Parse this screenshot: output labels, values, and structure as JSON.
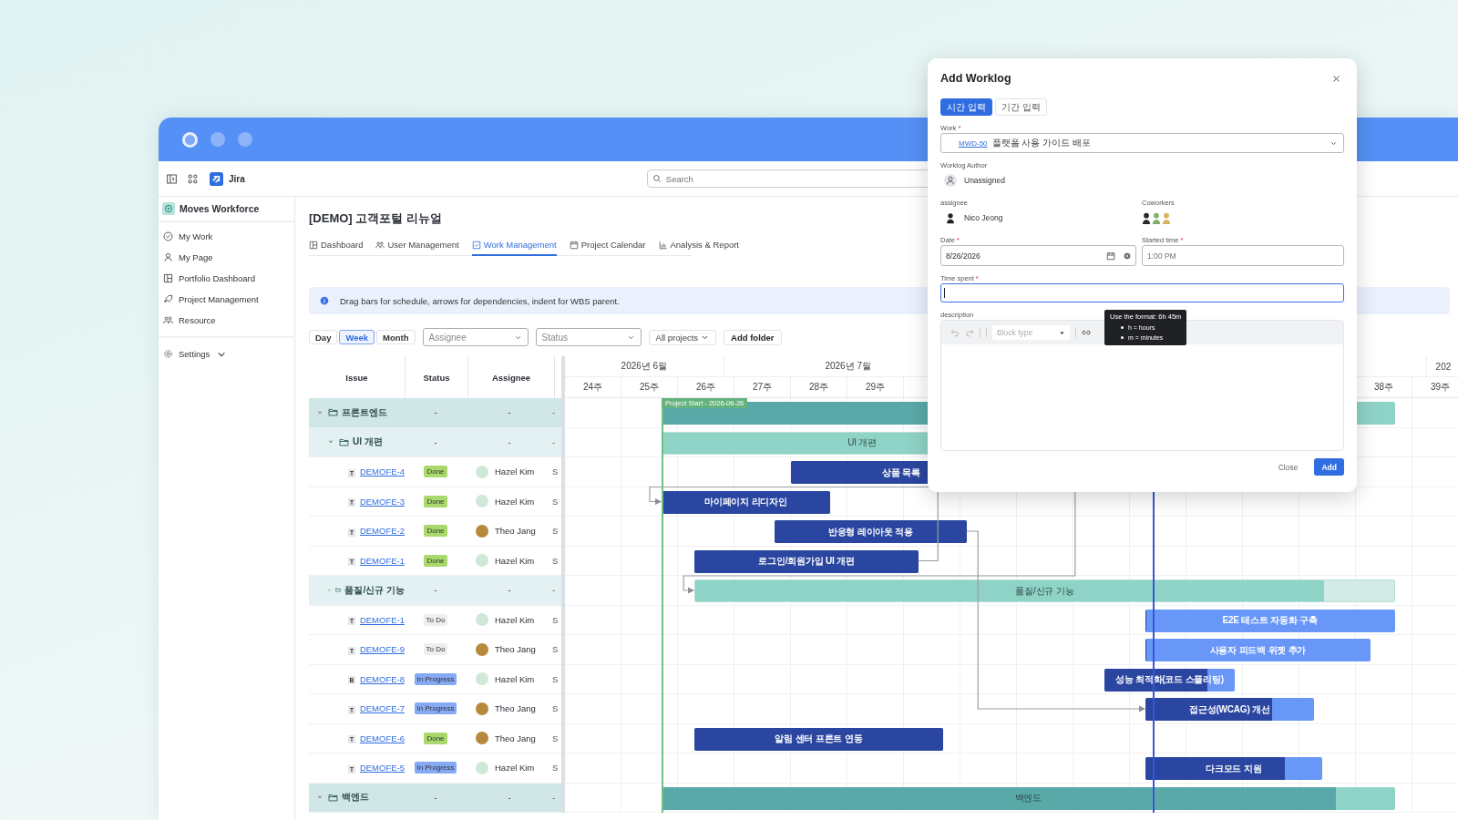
{
  "topbar": {
    "app_name": "Jira",
    "search": {
      "placeholder": "Search"
    }
  },
  "sidebar": {
    "workspace": "Moves Workforce",
    "items": [
      {
        "label": "My Work"
      },
      {
        "label": "My Page"
      },
      {
        "label": "Portfolio Dashboard"
      },
      {
        "label": "Project Management"
      },
      {
        "label": "Resource"
      }
    ],
    "settings": {
      "label": "Settings",
      "expanded": false
    }
  },
  "project": {
    "title": "[DEMO] 고객포털 리뉴얼",
    "tabs": [
      {
        "label": "Dashboard",
        "selected": false
      },
      {
        "label": "User Management",
        "selected": false
      },
      {
        "label": "Work Management",
        "selected": true
      },
      {
        "label": "Project Calendar",
        "selected": false
      },
      {
        "label": "Analysis & Report",
        "selected": false
      }
    ]
  },
  "banner": {
    "text": "Drag bars for schedule, arrows for dependencies, indent for WBS parent."
  },
  "toolbar": {
    "scales": [
      {
        "label": "Day",
        "selected": false
      },
      {
        "label": "Week",
        "selected": true
      },
      {
        "label": "Month",
        "selected": false
      }
    ],
    "assignee_filter": {
      "placeholder": "Assignee"
    },
    "status_filter": {
      "placeholder": "Status"
    },
    "project_filter": {
      "label": "All projects"
    },
    "add_folder": {
      "label": "Add folder"
    }
  },
  "table": {
    "columns": [
      "Issue",
      "Status",
      "Assignee"
    ],
    "rows": [
      {
        "kind": "group",
        "name": "프론트엔드",
        "expanded": true,
        "status": "-",
        "assignee": "-",
        "column_4": "-",
        "bar": {
          "level": 0.93
        },
        "children": [
          {
            "kind": "group",
            "name": "UI 개편",
            "expanded": true,
            "status": "-",
            "assignee": "-",
            "column_4": "-",
            "bar": {
              "label": "UI 개편",
              "level": 1
            },
            "children": [
              {
                "kind": "task",
                "type": "T",
                "key": "DEMOFE-4",
                "status": {
                  "label": "Done",
                  "color": "#a9d96c"
                },
                "assignee": {
                  "name": "Hazel Kim",
                  "color": "#cfe8d8"
                },
                "column_4": "S",
                "bar": {
                  "label": "상품 목록",
                  "level": 1
                }
              },
              {
                "kind": "task",
                "type": "T",
                "key": "DEMOFE-3",
                "status": {
                  "label": "Done",
                  "color": "#a9d96c"
                },
                "assignee": {
                  "name": "Hazel Kim",
                  "color": "#cfe8d8"
                },
                "column_4": "S",
                "bar": {
                  "label": "마이페이지 리디자인",
                  "level": 1
                }
              },
              {
                "kind": "task",
                "type": "T",
                "key": "DEMOFE-2",
                "status": {
                  "label": "Done",
                  "color": "#a9d96c"
                },
                "assignee": {
                  "name": "Theo Jang",
                  "color": "#b58a3c"
                },
                "column_4": "S",
                "bar": {
                  "label": "반응형 레이아웃 적용",
                  "level": 1
                }
              },
              {
                "kind": "task",
                "type": "T",
                "key": "DEMOFE-1",
                "status": {
                  "label": "Done",
                  "color": "#a9d96c"
                },
                "assignee": {
                  "name": "Hazel Kim",
                  "color": "#cfe8d8"
                },
                "column_4": "S",
                "bar": {
                  "label": "로그인/회원가입 UI 개편",
                  "level": 1
                }
              }
            ]
          },
          {
            "kind": "group",
            "name": "품질/신규 기능",
            "expanded": true,
            "status": "-",
            "assignee": "-",
            "column_4": "-",
            "bar": {
              "label": "품질/신규 기능",
              "level": 0.9
            },
            "children": [
              {
                "kind": "task",
                "type": "T",
                "key": "DEMOFE-1",
                "status": {
                  "label": "To Do",
                  "color": "#eeeeee"
                },
                "assignee": {
                  "name": "Hazel Kim",
                  "color": "#cfe8d8"
                },
                "column_4": "S",
                "bar": {
                  "label": "E2E 테스트 자동화 구축",
                  "level": 0
                }
              },
              {
                "kind": "task",
                "type": "T",
                "key": "DEMOFE-9",
                "status": {
                  "label": "To Do",
                  "color": "#eeeeee"
                },
                "assignee": {
                  "name": "Theo Jang",
                  "color": "#b58a3c"
                },
                "column_4": "S",
                "bar": {
                  "label": "사용자 피드백 위젯 추가",
                  "level": 0
                }
              },
              {
                "kind": "task",
                "type": "B",
                "key": "DEMOFE-8",
                "status": {
                  "label": "In Progress",
                  "color": "#86a9f3"
                },
                "assignee": {
                  "name": "Hazel Kim",
                  "color": "#cfe8d8"
                },
                "column_4": "S",
                "bar": {
                  "label": "성능 최적화(코드 스플리팅)",
                  "level": 0.79
                }
              },
              {
                "kind": "task",
                "type": "T",
                "key": "DEMOFE-7",
                "status": {
                  "label": "In Progress",
                  "color": "#86a9f3"
                },
                "assignee": {
                  "name": "Theo Jang",
                  "color": "#b58a3c"
                },
                "column_4": "S",
                "bar": {
                  "label": "접근성(WCAG) 개선",
                  "level": 0.75
                }
              },
              {
                "kind": "task",
                "type": "T",
                "key": "DEMOFE-6",
                "status": {
                  "label": "Done",
                  "color": "#a9d96c"
                },
                "assignee": {
                  "name": "Theo Jang",
                  "color": "#b58a3c"
                },
                "column_4": "S",
                "bar": {
                  "label": "알림 센터 프론트 연동",
                  "level": 1
                }
              },
              {
                "kind": "task",
                "type": "T",
                "key": "DEMOFE-5",
                "status": {
                  "label": "In Progress",
                  "color": "#86a9f3"
                },
                "assignee": {
                  "name": "Hazel Kim",
                  "color": "#cfe8d8"
                },
                "column_4": "S",
                "bar": {
                  "label": "다크모드 지원",
                  "level": 0.79
                }
              }
            ]
          }
        ]
      },
      {
        "kind": "group",
        "name": "백엔드",
        "expanded": true,
        "status": "-",
        "assignee": "-",
        "column_4": "-",
        "bar": {
          "label": "백엔드",
          "level": 0.92
        }
      }
    ]
  },
  "gantt": {
    "months": [
      "2026년 6월",
      "2026년 7월",
      "202"
    ],
    "weeks_left": [
      "24주",
      "25주",
      "26주",
      "27주",
      "28주",
      "29주"
    ],
    "weeks_right": [
      "38주",
      "39주"
    ],
    "project_start": {
      "label": "Project Start - 2026-06-26"
    }
  },
  "dialog": {
    "title": "Add Worklog",
    "mode_tabs": [
      {
        "label": "시간 입력",
        "selected": true
      },
      {
        "label": "기간 입력",
        "selected": false
      }
    ],
    "work": {
      "label": "Work",
      "required_mark": "*",
      "key": "MWD-50",
      "title": "플랫폼 사용 가이드 배포"
    },
    "author": {
      "label": "Worklog Author",
      "value": "Unassigned"
    },
    "assignee": {
      "label": "assignee",
      "value": "Nico Jeong"
    },
    "coworkers": {
      "label": "Coworkers",
      "avatars": [
        {
          "color": "#2a2a2a"
        },
        {
          "color": "#7fae6a"
        },
        {
          "color": "#d8b45a"
        }
      ]
    },
    "date": {
      "label": "Date",
      "required_mark": "*",
      "value": "8/26/2026"
    },
    "started_time": {
      "label": "Started time",
      "required_mark": "*",
      "placeholder": "1:00 PM"
    },
    "time_spent": {
      "label": "Time spent",
      "required_mark": "*",
      "focused": true
    },
    "description": {
      "label": "description",
      "block_type": {
        "placeholder": "Block type"
      }
    },
    "tooltip": {
      "title": "Use the format: 6h 45m",
      "items": [
        "h = hours",
        "m = minutes"
      ]
    },
    "buttons": [
      {
        "label": "Close",
        "kind": "secondary"
      },
      {
        "label": "Add",
        "kind": "primary"
      }
    ]
  }
}
